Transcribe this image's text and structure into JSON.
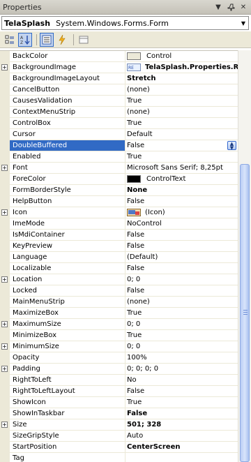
{
  "window": {
    "title": "Properties"
  },
  "object_selector": {
    "name": "TelaSplash",
    "type": "System.Windows.Forms.Form"
  },
  "toolbar": {
    "tools": [
      "categorized-icon",
      "alphabetical-icon",
      "properties-icon",
      "events-icon",
      "property-pages-icon"
    ],
    "active": [
      "alphabetical-icon",
      "properties-icon"
    ]
  },
  "properties": [
    {
      "name": "BackColor",
      "value": "Control",
      "swatch": "#ece9d8"
    },
    {
      "name": "BackgroundImage",
      "value": "TelaSplash.Properties.Re",
      "expandable": true,
      "bold": true,
      "image": true
    },
    {
      "name": "BackgroundImageLayout",
      "value": "Stretch",
      "bold": true
    },
    {
      "name": "CancelButton",
      "value": "(none)"
    },
    {
      "name": "CausesValidation",
      "value": "True"
    },
    {
      "name": "ContextMenuStrip",
      "value": "(none)"
    },
    {
      "name": "ControlBox",
      "value": "True"
    },
    {
      "name": "Cursor",
      "value": "Default"
    },
    {
      "name": "DoubleBuffered",
      "value": "False",
      "selected": true
    },
    {
      "name": "Enabled",
      "value": "True"
    },
    {
      "name": "Font",
      "value": "Microsoft Sans Serif; 8,25pt",
      "expandable": true
    },
    {
      "name": "ForeColor",
      "value": "ControlText",
      "swatch": "#000000"
    },
    {
      "name": "FormBorderStyle",
      "value": "None",
      "bold": true
    },
    {
      "name": "HelpButton",
      "value": "False"
    },
    {
      "name": "Icon",
      "value": "(Icon)",
      "expandable": true,
      "icon": true
    },
    {
      "name": "ImeMode",
      "value": "NoControl"
    },
    {
      "name": "IsMdiContainer",
      "value": "False"
    },
    {
      "name": "KeyPreview",
      "value": "False"
    },
    {
      "name": "Language",
      "value": "(Default)"
    },
    {
      "name": "Localizable",
      "value": "False"
    },
    {
      "name": "Location",
      "value": "0; 0",
      "expandable": true
    },
    {
      "name": "Locked",
      "value": "False"
    },
    {
      "name": "MainMenuStrip",
      "value": "(none)"
    },
    {
      "name": "MaximizeBox",
      "value": "True"
    },
    {
      "name": "MaximumSize",
      "value": "0; 0",
      "expandable": true
    },
    {
      "name": "MinimizeBox",
      "value": "True"
    },
    {
      "name": "MinimumSize",
      "value": "0; 0",
      "expandable": true
    },
    {
      "name": "Opacity",
      "value": "100%"
    },
    {
      "name": "Padding",
      "value": "0; 0; 0; 0",
      "expandable": true
    },
    {
      "name": "RightToLeft",
      "value": "No"
    },
    {
      "name": "RightToLeftLayout",
      "value": "False"
    },
    {
      "name": "ShowIcon",
      "value": "True"
    },
    {
      "name": "ShowInTaskbar",
      "value": "False",
      "bold": true
    },
    {
      "name": "Size",
      "value": "501; 328",
      "expandable": true,
      "bold": true
    },
    {
      "name": "SizeGripStyle",
      "value": "Auto"
    },
    {
      "name": "StartPosition",
      "value": "CenterScreen",
      "bold": true
    },
    {
      "name": "Tag",
      "value": ""
    }
  ],
  "colors": {
    "selection": "#316ac5",
    "chrome": "#ece9d8"
  }
}
